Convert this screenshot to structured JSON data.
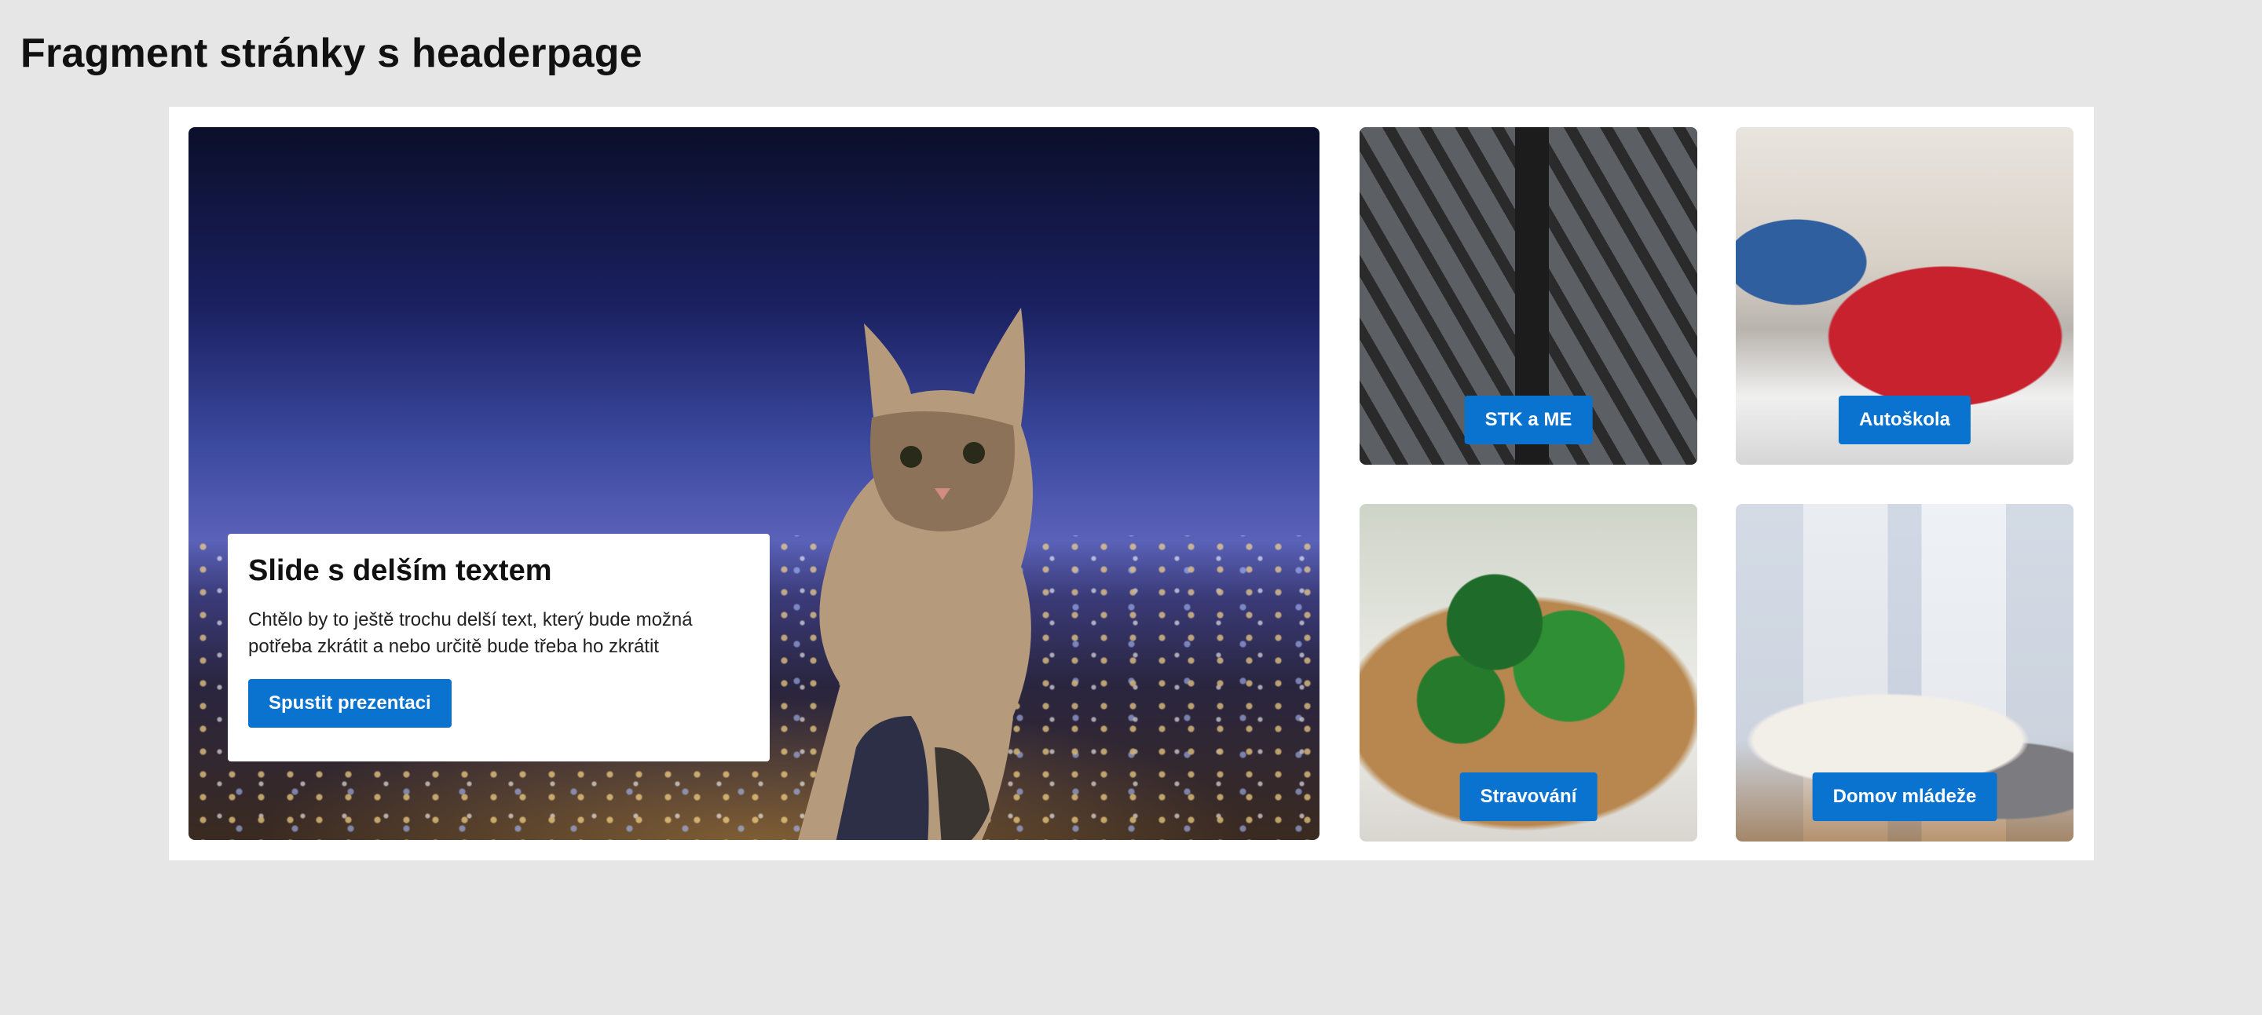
{
  "page": {
    "title": "Fragment stránky s headerpage"
  },
  "hero": {
    "image_icon": "cat-on-rooftop-night-city-image",
    "slide_title": "Slide s delším textem",
    "slide_text": "Chtělo by to ještě trochu delší text, který bude možná potřeba zkrátit a nebo určitě bude třeba ho zkrátit",
    "button_label": "Spustit prezentaci"
  },
  "tiles": [
    {
      "label": "STK a ME",
      "image_icon": "car-inspection-lift-image"
    },
    {
      "label": "Autoškola",
      "image_icon": "driving-school-car-image"
    },
    {
      "label": "Stravování",
      "image_icon": "food-toast-spinach-image"
    },
    {
      "label": "Domov mládeže",
      "image_icon": "dormitory-bedroom-image"
    }
  ],
  "colors": {
    "background": "#e6e6e6",
    "panel": "#ffffff",
    "button": "#0a72cf",
    "button_text": "#ffffff"
  }
}
